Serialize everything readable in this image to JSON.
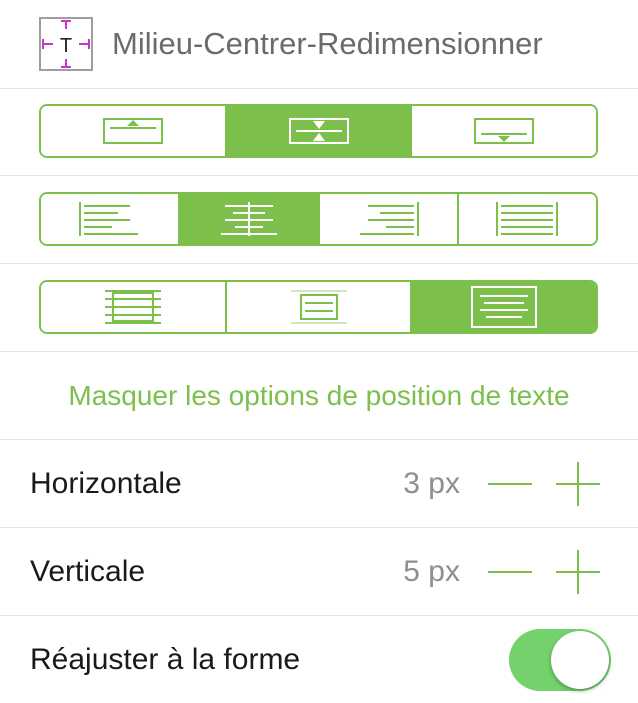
{
  "header": {
    "icon_name": "text-center-resize-icon",
    "title": "Milieu-Centrer-Redimensionner"
  },
  "vertical_align": {
    "options": [
      "align-top-icon",
      "align-middle-icon",
      "align-bottom-icon"
    ],
    "selected": "align-middle-icon"
  },
  "horizontal_align": {
    "options": [
      "align-left-icon",
      "align-center-icon",
      "align-right-icon",
      "align-justify-icon"
    ],
    "selected": "align-center-icon"
  },
  "wrap_mode": {
    "options": [
      "text-overflow-icon",
      "text-clip-icon",
      "text-fit-icon"
    ],
    "selected": "text-fit-icon"
  },
  "toggle_link": "Masquer les options de position de texte",
  "horizontal": {
    "label": "Horizontale",
    "value": "3 px"
  },
  "vertical": {
    "label": "Verticale",
    "value": "5 px"
  },
  "fit_to_shape": {
    "label": "Réajuster à la forme",
    "on": true
  },
  "colors": {
    "accent": "#7cc04b",
    "toggle_on": "#74d26c",
    "handle_magenta": "#cc33cc"
  }
}
